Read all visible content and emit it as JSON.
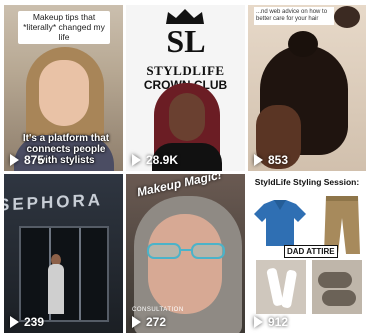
{
  "videos": [
    {
      "caption_top": "Makeup tips that *literally* changed my life",
      "caption_overlay": "It's a platform that connects people with stylists",
      "views": "875"
    },
    {
      "brand_line1": "SL",
      "brand_line2": "STYLDLIFE",
      "brand_line3": "CROWN CLUB",
      "views": "28.9K"
    },
    {
      "note": "...nd web advice on how to better care for your hair",
      "views": "853"
    },
    {
      "storefront_sign": "SEPHORA",
      "views": "239"
    },
    {
      "overlay": "Makeup Magic!",
      "corner_text": "CONSULTATION",
      "views": "272"
    },
    {
      "title": "StyldLife Styling Session:",
      "label": "DAD ATTIRE",
      "views": "912"
    }
  ],
  "colors": {
    "view_text": "#ffffff",
    "play_icon": "#ffffff",
    "shirt_blue": "#2f6fb3",
    "pants_khaki": "#a78a5c"
  }
}
